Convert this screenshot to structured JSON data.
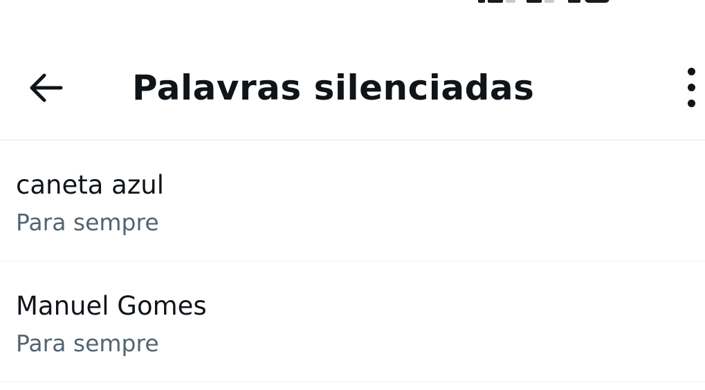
{
  "header": {
    "title": "Palavras silenciadas",
    "back_icon": "arrow-left-icon",
    "more_icon": "more-vertical-icon"
  },
  "muted_words": [
    {
      "word": "caneta azul",
      "duration": "Para sempre"
    },
    {
      "word": "Manuel Gomes",
      "duration": "Para sempre"
    }
  ],
  "colors": {
    "text_primary": "#0f1419",
    "text_secondary": "#536471",
    "divider": "#dfe4e8"
  }
}
